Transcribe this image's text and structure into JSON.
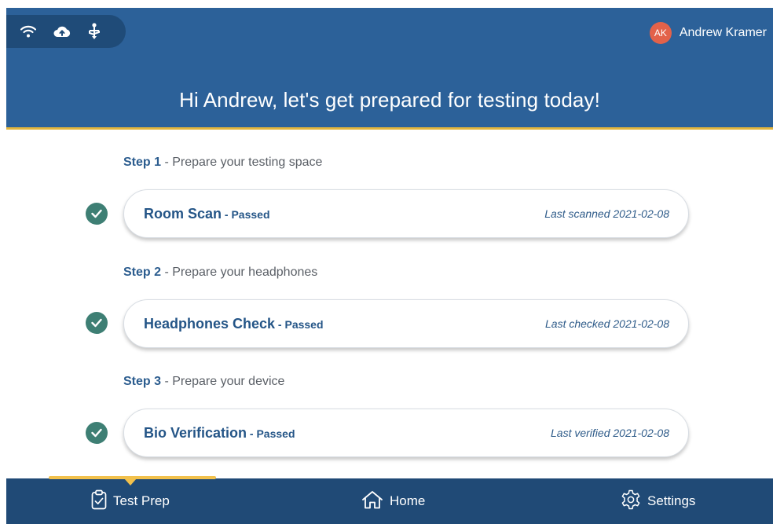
{
  "header": {
    "greeting": "Hi Andrew, let's get prepared for testing today!",
    "user": {
      "initials": "AK",
      "name": "Andrew Kramer"
    },
    "status_icons": [
      "wifi-icon",
      "cloud-upload-icon",
      "usb-icon"
    ]
  },
  "steps": [
    {
      "step_number": "Step 1",
      "step_text": " - Prepare your testing space",
      "title": "Room Scan",
      "status": " - Passed",
      "meta": "Last scanned 2021-02-08"
    },
    {
      "step_number": "Step 2",
      "step_text": " - Prepare your headphones",
      "title": "Headphones Check",
      "status": " - Passed",
      "meta": "Last checked 2021-02-08"
    },
    {
      "step_number": "Step 3",
      "step_text": " - Prepare your device",
      "title": "Bio Verification",
      "status": " - Passed",
      "meta": "Last verified 2021-02-08"
    }
  ],
  "nav": {
    "items": [
      {
        "label": "Test Prep",
        "icon": "clipboard-check-icon",
        "active": true
      },
      {
        "label": "Home",
        "icon": "home-icon",
        "active": false
      },
      {
        "label": "Settings",
        "icon": "gear-icon",
        "active": false
      }
    ]
  },
  "colors": {
    "header_bg": "#2c6199",
    "accent": "#f2c14c",
    "check_green": "#3e7f74",
    "nav_bg": "#204a76"
  }
}
